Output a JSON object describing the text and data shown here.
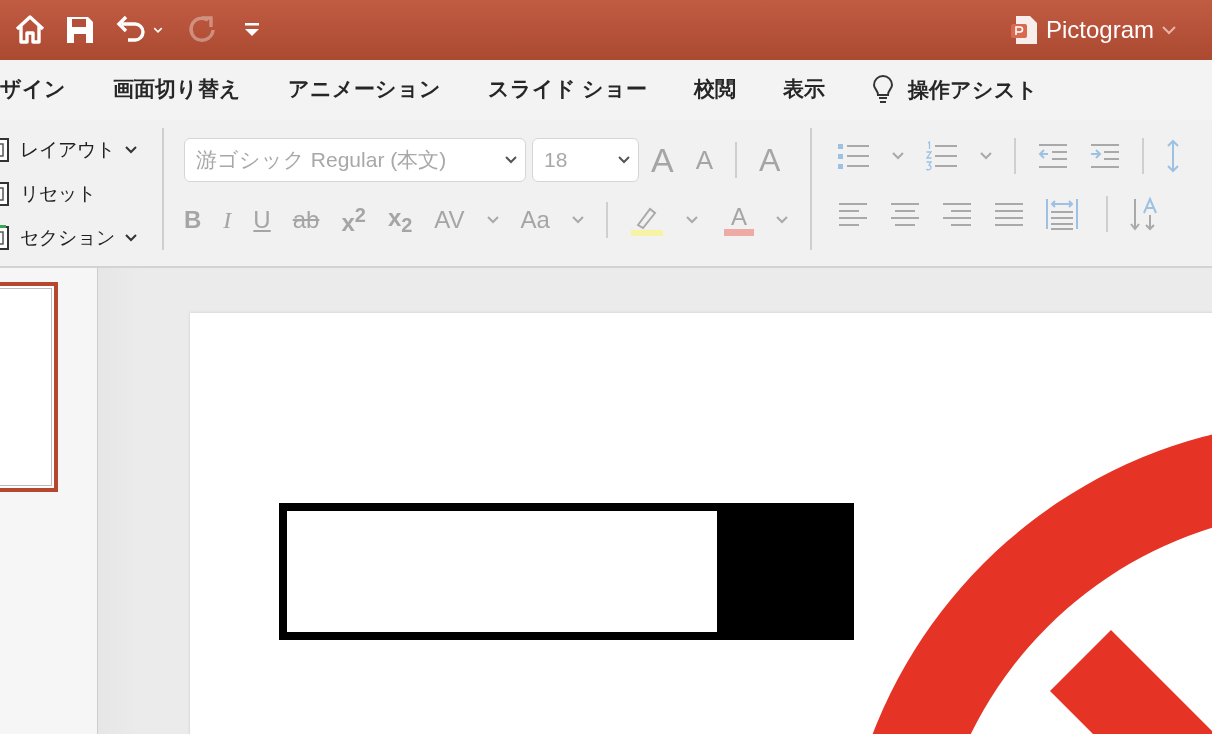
{
  "title_bar": {
    "quick_access": [
      {
        "kind": "home",
        "disabled": false
      },
      {
        "kind": "save",
        "disabled": false
      },
      {
        "kind": "undo",
        "disabled": false
      },
      {
        "kind": "undo-menu",
        "disabled": false
      },
      {
        "kind": "redo",
        "disabled": true
      },
      {
        "kind": "customize",
        "disabled": false
      }
    ],
    "document_title": "Pictogram"
  },
  "tabs": [
    {
      "label": "ザイン",
      "selected": false
    },
    {
      "label": "画面切り替え",
      "selected": false
    },
    {
      "label": "アニメーション",
      "selected": false
    },
    {
      "label": "スライド ショー",
      "selected": false
    },
    {
      "label": "校閲",
      "selected": false
    },
    {
      "label": "表示",
      "selected": false
    }
  ],
  "tell_me": {
    "label": "操作アシスト"
  },
  "slides_group": {
    "items": [
      {
        "label": "レイアウト",
        "menu": true
      },
      {
        "label": "リセット",
        "menu": false
      },
      {
        "label": "セクション",
        "menu": true
      }
    ]
  },
  "font_group": {
    "disabled": true,
    "font_name": "游ゴシック Regular (本文)",
    "font_size": "18",
    "buttons": [
      {
        "kind": "bold",
        "label": "B"
      },
      {
        "kind": "italic",
        "label": "I"
      },
      {
        "kind": "underline",
        "label": "U"
      },
      {
        "kind": "strike",
        "label": "ab"
      },
      {
        "kind": "script",
        "label": "x$^{2}$"
      },
      {
        "kind": "script",
        "label": "x$_{2}$"
      },
      {
        "kind": "spacing",
        "label": "AV"
      },
      {
        "kind": "case",
        "label": "Aa"
      }
    ],
    "grow_label": "A",
    "shrink_label": "A",
    "clear_label": "A",
    "color_label": "A"
  },
  "paragraph_group": {
    "disabled": true
  },
  "slides": [
    {
      "selected": true
    }
  ]
}
